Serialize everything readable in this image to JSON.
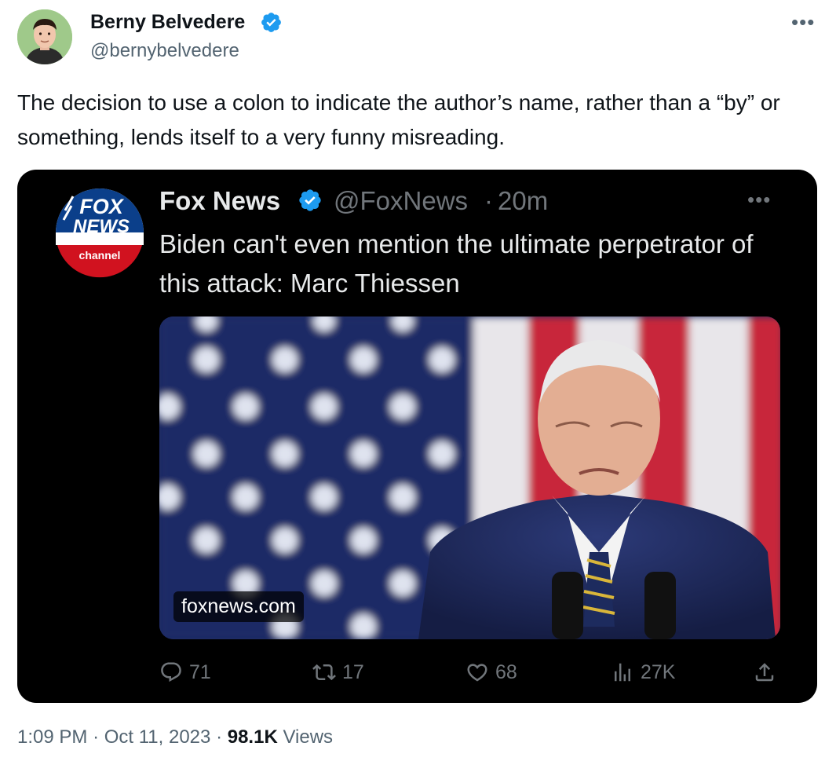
{
  "author": {
    "name": "Berny Belvedere",
    "handle": "@bernybelvedere"
  },
  "tweet": {
    "text": "The decision to use a colon to indicate the author’s name, rather than a “by” or something, lends itself to a very funny misreading."
  },
  "quoted": {
    "name": "Fox News",
    "handle": "@FoxNews",
    "separator": "·",
    "time": "20m",
    "text": "Biden can't even mention the ultimate perpetrator of this attack: Marc Thiessen",
    "media_domain": "foxnews.com",
    "logo_text": [
      "FOX",
      "NEWS",
      "channel"
    ],
    "stats": {
      "replies": "71",
      "reposts": "17",
      "likes": "68",
      "views": "27K"
    }
  },
  "footer": {
    "time": "1:09 PM",
    "date": "Oct 11, 2023",
    "separator": "·",
    "views_count": "98.1K",
    "views_label": "Views"
  },
  "colors": {
    "verified": "#1d9bf0",
    "text_primary": "#0f1419",
    "text_secondary": "#536471",
    "embed_bg": "#000000",
    "embed_text": "#e7e9ea",
    "embed_muted": "#71767b"
  },
  "icons": [
    "verified-badge-icon",
    "more-icon",
    "reply-icon",
    "repost-icon",
    "like-icon",
    "views-icon",
    "share-icon"
  ]
}
